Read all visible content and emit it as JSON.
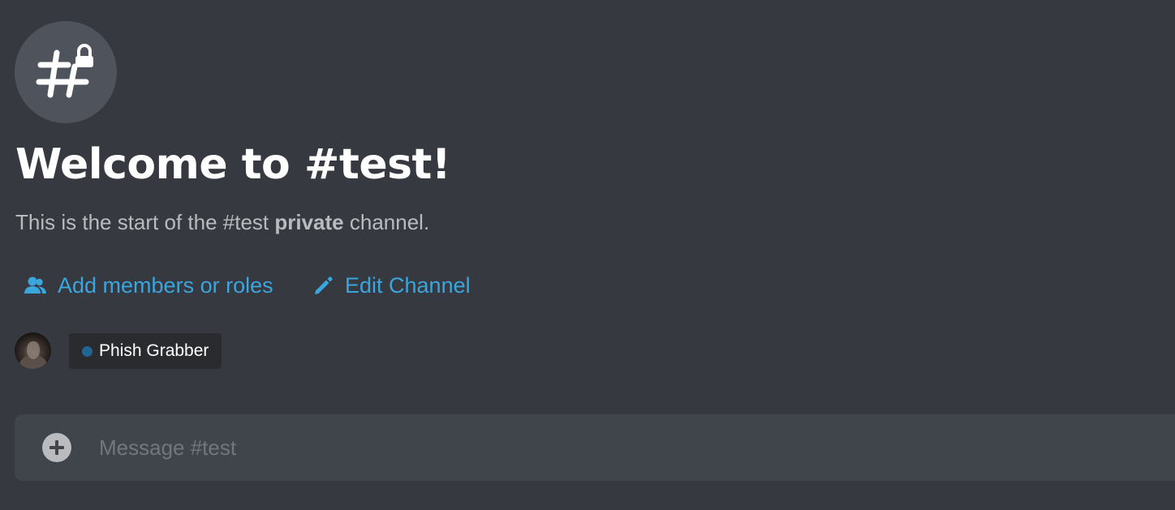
{
  "channel": {
    "icon": "hashtag-lock-icon",
    "title": "Welcome to #test!",
    "intro_prefix": "This is the start of the #test ",
    "intro_bold": "private",
    "intro_suffix": " channel."
  },
  "actions": {
    "add_members": {
      "label": "Add members or roles",
      "icon": "add-members-icon"
    },
    "edit_channel": {
      "label": "Edit Channel",
      "icon": "pencil-icon"
    }
  },
  "members": {
    "role": {
      "name": "Phish Grabber",
      "color": "#206694"
    }
  },
  "composer": {
    "placeholder": "Message #test",
    "attach_icon": "plus-circle-icon"
  },
  "colors": {
    "background": "#36393f",
    "link": "#3ba5dd",
    "composer_bg": "#40444b"
  }
}
